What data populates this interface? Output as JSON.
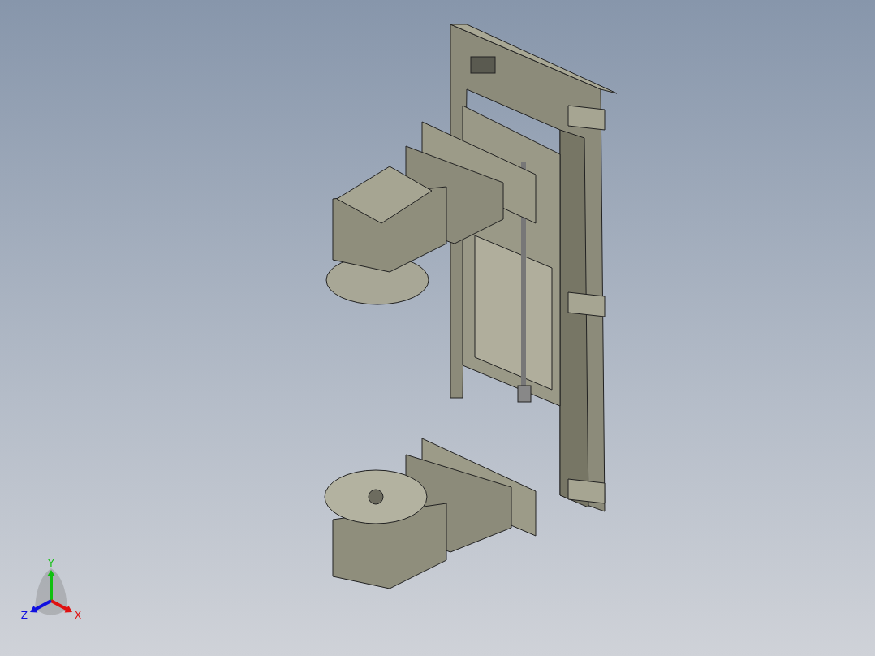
{
  "viewport": {
    "triad": {
      "axes": [
        {
          "label": "Y",
          "color": "#10c010"
        },
        {
          "label": "X",
          "color": "#e01010"
        },
        {
          "label": "Z",
          "color": "#1010e0"
        }
      ]
    }
  }
}
